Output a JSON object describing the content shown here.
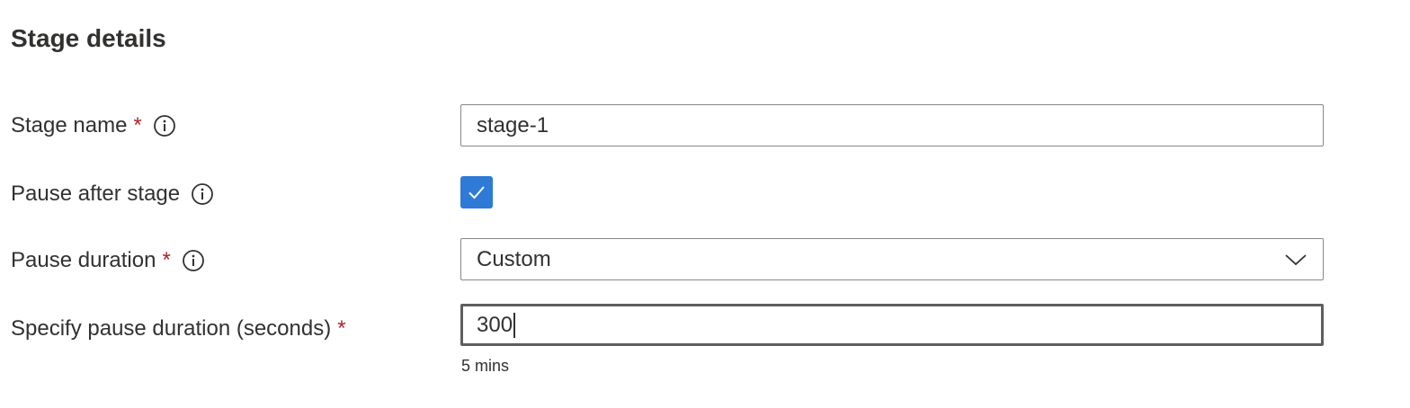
{
  "section": {
    "title": "Stage details"
  },
  "fields": {
    "stage_name": {
      "label": "Stage name",
      "required_mark": "*",
      "value": "stage-1"
    },
    "pause_after_stage": {
      "label": "Pause after stage",
      "checked": true
    },
    "pause_duration": {
      "label": "Pause duration",
      "required_mark": "*",
      "selected": "Custom"
    },
    "specify_pause_duration": {
      "label": "Specify pause duration (seconds)",
      "required_mark": "*",
      "value": "300",
      "hint": "5 mins"
    }
  },
  "icons": {
    "info": "info-icon",
    "check": "checkmark-icon",
    "chevron": "chevron-down-icon"
  },
  "colors": {
    "checkbox_bg": "#2f7ad6",
    "required": "#a4262c",
    "text": "#323130",
    "border": "#8a8886"
  }
}
